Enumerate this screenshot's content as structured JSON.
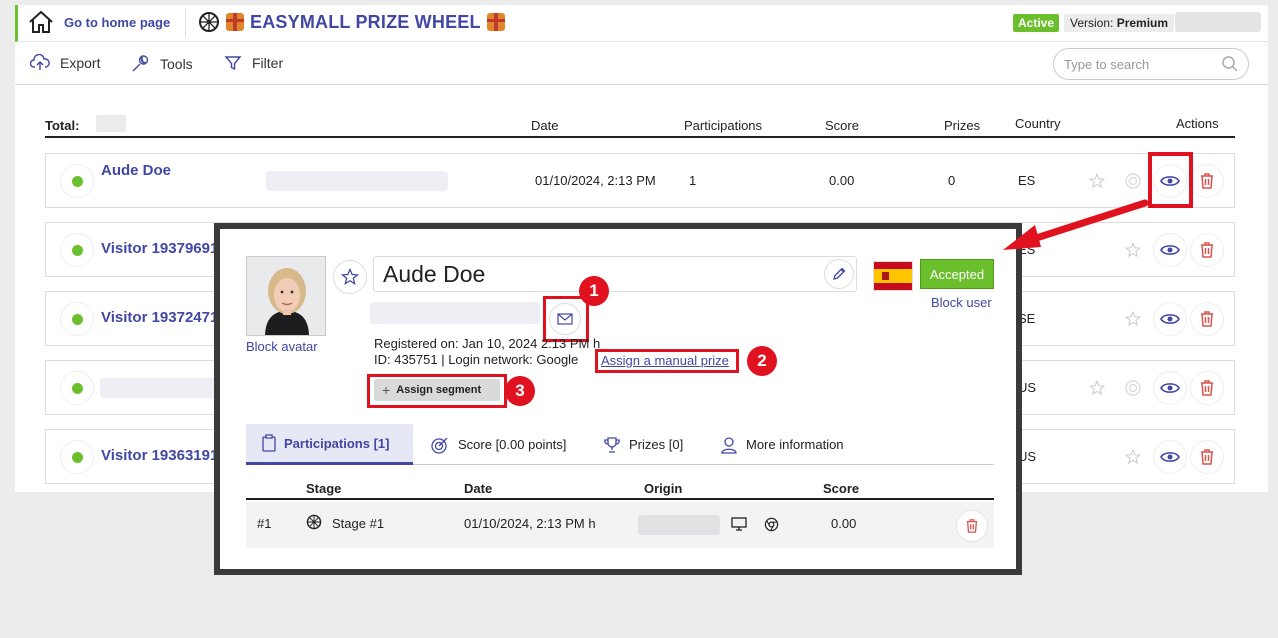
{
  "topbar": {
    "home_label": "Go to home page",
    "brand_title": "EASYMALL PRIZE WHEEL",
    "status_badge": "Active",
    "version_prefix": "Version:",
    "version_value": "Premium"
  },
  "toolbar": {
    "export_label": "Export",
    "tools_label": "Tools",
    "filter_label": "Filter",
    "search_placeholder": "Type to search"
  },
  "table": {
    "total_label": "Total:",
    "headers": {
      "date": "Date",
      "participations": "Participations",
      "score": "Score",
      "prizes": "Prizes",
      "country": "Country",
      "actions": "Actions"
    },
    "rows": [
      {
        "name": "Aude Doe",
        "date": "01/10/2024, 2:13 PM",
        "participations": "1",
        "score": "0.00",
        "prizes": "0",
        "country": "ES"
      },
      {
        "name": "Visitor 19379691",
        "country": "ES"
      },
      {
        "name": "Visitor 19372471",
        "country": "SE"
      },
      {
        "name": "",
        "country": "US"
      },
      {
        "name": "Visitor 19363191",
        "country": "US"
      }
    ]
  },
  "modal": {
    "user_name": "Aude Doe",
    "block_avatar": "Block avatar",
    "status": "Accepted",
    "block_user": "Block user",
    "registered": "Registered on: Jan 10, 2024 2:13 PM h",
    "id_line": "ID: 435751 | Login network: Google",
    "assign_prize": "Assign a manual prize",
    "assign_segment": "Assign segment",
    "callouts": [
      "1",
      "2",
      "3"
    ],
    "tabs": [
      {
        "label": "Participations [1]"
      },
      {
        "label": "Score [0.00 points]"
      },
      {
        "label": "Prizes [0]"
      },
      {
        "label": "More information"
      }
    ],
    "participations": {
      "headers": {
        "stage": "Stage",
        "date": "Date",
        "origin": "Origin",
        "score": "Score"
      },
      "row": {
        "index": "#1",
        "stage": "Stage #1",
        "date": "01/10/2024, 2:13 PM h",
        "score": "0.00"
      }
    }
  },
  "colors": {
    "accent": "#4147a3",
    "active_green": "#6cbf2c",
    "highlight_red": "#e0121f",
    "delete_red": "#d9534f"
  }
}
